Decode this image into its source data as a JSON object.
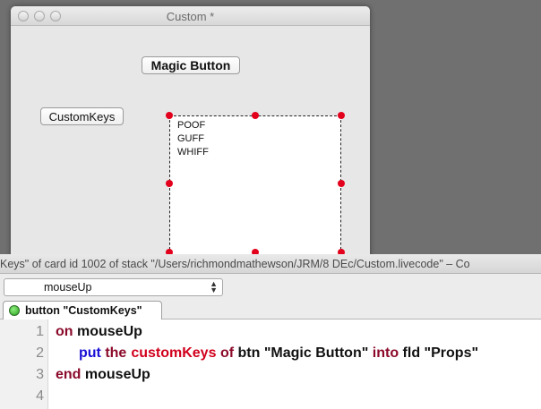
{
  "window": {
    "title": "Custom *"
  },
  "card": {
    "magic_button_label": "Magic Button",
    "customkeys_button_label": "CustomKeys",
    "field_lines": [
      "POOF",
      "GUFF",
      "WHIFF"
    ]
  },
  "editor": {
    "title_text": "Keys\" of card id 1002 of stack \"/Users/richmondmathewson/JRM/8 DEc/Custom.livecode\" – Co",
    "handler_select_value": "mouseUp",
    "tab_label": "button \"CustomKeys\"",
    "line_numbers": [
      "1",
      "2",
      "3",
      "4"
    ],
    "code": {
      "line1": {
        "kw": "on",
        "rest": "mouseUp"
      },
      "line2": {
        "put": "put",
        "the": "the",
        "prop": "customKeys",
        "of": "of",
        "btn_phrase": "btn \"Magic Button\"",
        "into": "into",
        "fld_phrase": "fld \"Props\""
      },
      "line3": {
        "kw": "end",
        "rest": "mouseUp"
      }
    }
  },
  "colors": {
    "handle_red": "#e3001c",
    "keyword_maroon": "#8b0a2a",
    "command_blue": "#1a10d6",
    "property_red": "#d1001c"
  }
}
